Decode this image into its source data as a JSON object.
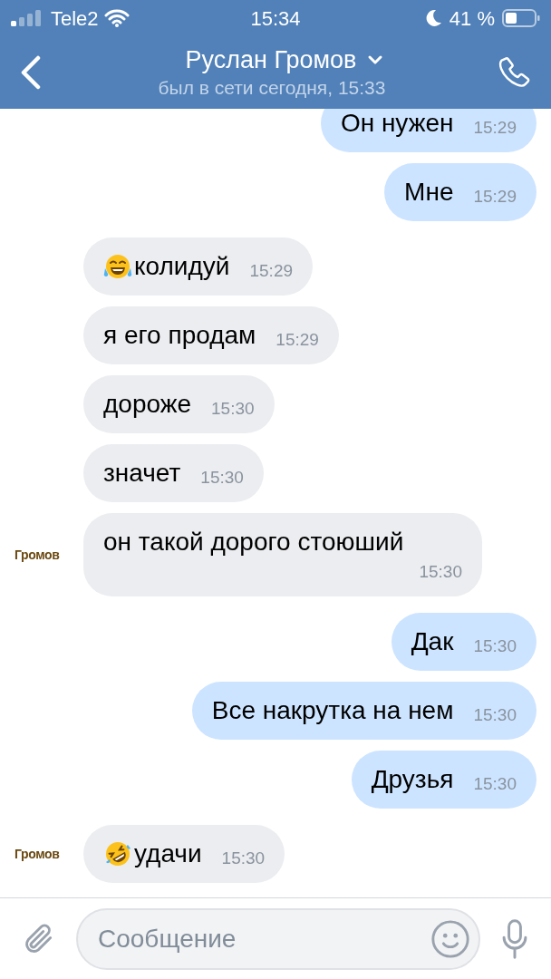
{
  "status_bar": {
    "carrier": "Tele2",
    "time": "15:34",
    "battery": "41 %"
  },
  "header": {
    "title": "Руслан Громов",
    "subtitle": "был в сети сегодня, 15:33"
  },
  "messages": [
    {
      "kind": "outgoing",
      "text": "Он нужен",
      "time": "15:29"
    },
    {
      "kind": "outgoing",
      "text": "Мне",
      "time": "15:29"
    },
    {
      "kind": "incoming",
      "emoji": {
        "kind": "joy"
      },
      "text": "колидуй",
      "time": "15:29"
    },
    {
      "kind": "incoming",
      "text": "я его продам",
      "time": "15:29"
    },
    {
      "kind": "incoming",
      "text": "дороже",
      "time": "15:30"
    },
    {
      "kind": "incoming",
      "text": "значет",
      "time": "15:30"
    },
    {
      "kind": "incoming",
      "text": "он такой дорого стоюший",
      "time": "15:30",
      "sender": "Громов"
    },
    {
      "kind": "outgoing",
      "text": "Дак",
      "time": "15:30"
    },
    {
      "kind": "outgoing",
      "text": "Все накрутка на нем",
      "time": "15:30"
    },
    {
      "kind": "outgoing",
      "text": "Друзья",
      "time": "15:30"
    },
    {
      "kind": "incoming",
      "emoji": {
        "kind": "rofl"
      },
      "text": "удачи",
      "time": "15:30",
      "sender": "Громов"
    }
  ],
  "composer": {
    "placeholder": "Сообщение"
  }
}
